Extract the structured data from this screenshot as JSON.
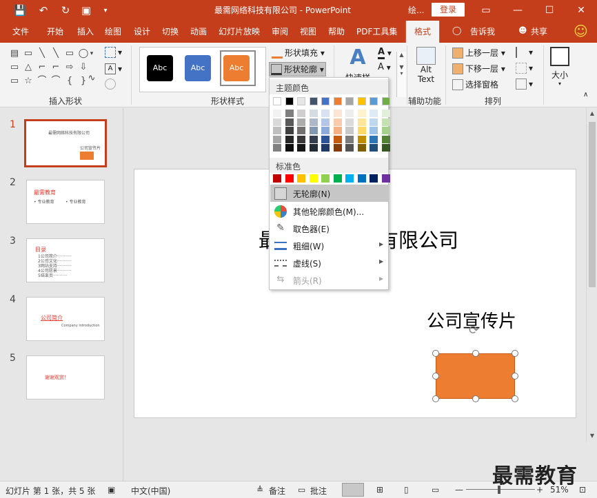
{
  "titlebar": {
    "title": "最需网络科技有限公司  -  PowerPoint",
    "account": "绘...",
    "login": "登录",
    "qa_save": "💾",
    "qa_undo": "↶",
    "qa_redo": "↻",
    "qa_present": "▣",
    "qa_customize": "▾",
    "ribbon_options": "▭",
    "minimize": "—",
    "maximize": "☐",
    "close": "✕"
  },
  "tabs": [
    "文件",
    "开始",
    "插入",
    "绘图",
    "设计",
    "切换",
    "动画",
    "幻灯片放映",
    "审阅",
    "视图",
    "帮助",
    "PDF工具集"
  ],
  "active_tab": "格式",
  "tell_me": "告诉我",
  "share": "共享",
  "smiley": "☺",
  "ribbon": {
    "insert_shapes_label": "插入形状",
    "shape_styles_label": "形状样式",
    "accessibility_label": "辅助功能",
    "arrange_label": "排列",
    "shape_fill": "形状填充",
    "shape_outline": "形状轮廓",
    "quick_styles": "快速样式",
    "alt_text_line1": "Alt",
    "alt_text_line2": "Text",
    "bring_forward": "上移一层",
    "send_backward": "下移一层",
    "selection_pane": "选择窗格",
    "size": "大小",
    "style_abc": [
      "Abc",
      "Abc",
      "Abc"
    ],
    "shape_glyphs": [
      "▤",
      "▭",
      "╲",
      "╲",
      "▭",
      "◯",
      "▭",
      "△",
      "⌐",
      "⌐",
      "⇨",
      "⇩",
      "▭",
      "☆",
      "⌒",
      "⌒",
      "{",
      "}",
      "∿",
      "▾"
    ]
  },
  "colors": {
    "accent": "#c43e1c",
    "theme_top": [
      "#ffffff",
      "#000000",
      "#e7e6e6",
      "#44546a",
      "#4472c4",
      "#ed7d31",
      "#a5a5a5",
      "#ffc000",
      "#5b9bd5",
      "#70ad47"
    ],
    "theme_shades": [
      [
        "#f2f2f2",
        "#d9d9d9",
        "#bfbfbf",
        "#a6a6a6",
        "#808080"
      ],
      [
        "#7f7f7f",
        "#595959",
        "#404040",
        "#262626",
        "#0d0d0d"
      ],
      [
        "#d0cece",
        "#aeabab",
        "#757070",
        "#3a3838",
        "#171616"
      ],
      [
        "#d6dce4",
        "#adb9ca",
        "#8497b0",
        "#333f4f",
        "#222a35"
      ],
      [
        "#d9e2f3",
        "#b4c6e7",
        "#8eaadb",
        "#2f5496",
        "#1f3864"
      ],
      [
        "#fbe5d5",
        "#f7cbac",
        "#f4b183",
        "#c55a11",
        "#833c0b"
      ],
      [
        "#ededed",
        "#dbdbdb",
        "#c9c9c9",
        "#7b7b7b",
        "#525252"
      ],
      [
        "#fff2cc",
        "#fee599",
        "#ffd965",
        "#bf8f00",
        "#7f6000"
      ],
      [
        "#deeaf6",
        "#bdd7ee",
        "#9cc3e5",
        "#2e75b5",
        "#1f4e79"
      ],
      [
        "#e2efd9",
        "#c5e0b3",
        "#a8d08d",
        "#538135",
        "#375623"
      ]
    ],
    "standard": [
      "#c00000",
      "#ff0000",
      "#ffc000",
      "#ffff00",
      "#92d050",
      "#00b050",
      "#00b0f0",
      "#0070c0",
      "#002060",
      "#7030a0"
    ]
  },
  "dropdown": {
    "theme_colors_header": "主题颜色",
    "standard_colors_header": "标准色",
    "no_outline": "无轮廓(N)",
    "more_colors": "其他轮廓颜色(M)...",
    "eyedropper": "取色器(E)",
    "weight": "粗细(W)",
    "dashes": "虚线(S)",
    "arrows": "箭头(R)",
    "submenu_arrow": "▶"
  },
  "slides": [
    {
      "num": "1",
      "title": "最需网络科技有限公司",
      "sub": "公司宣传片"
    },
    {
      "num": "2",
      "title": "最需教育",
      "b1": "• 专业教育",
      "b2": "• 专业教育"
    },
    {
      "num": "3",
      "title": "目录",
      "lines": [
        "1公司简介···········",
        "2公司文化···········",
        "3网站支持···········",
        "4公司愿景···········",
        "5结束页···········"
      ]
    },
    {
      "num": "4",
      "title": "公司简介",
      "sub": "Company introduction"
    },
    {
      "num": "5",
      "title": "谢谢观赏！"
    }
  ],
  "slide": {
    "title": "最需网络科技有限公司",
    "subtitle": "公司宣传片",
    "rotate_icon": "⟳"
  },
  "status": {
    "slide_info": "幻灯片 第 1 张，共 5 张",
    "language": "中文(中国)",
    "notes": "备注",
    "comments": "批注",
    "zoom": "51%",
    "zoom_minus": "—",
    "zoom_plus": "+"
  },
  "watermark": "最需教育"
}
